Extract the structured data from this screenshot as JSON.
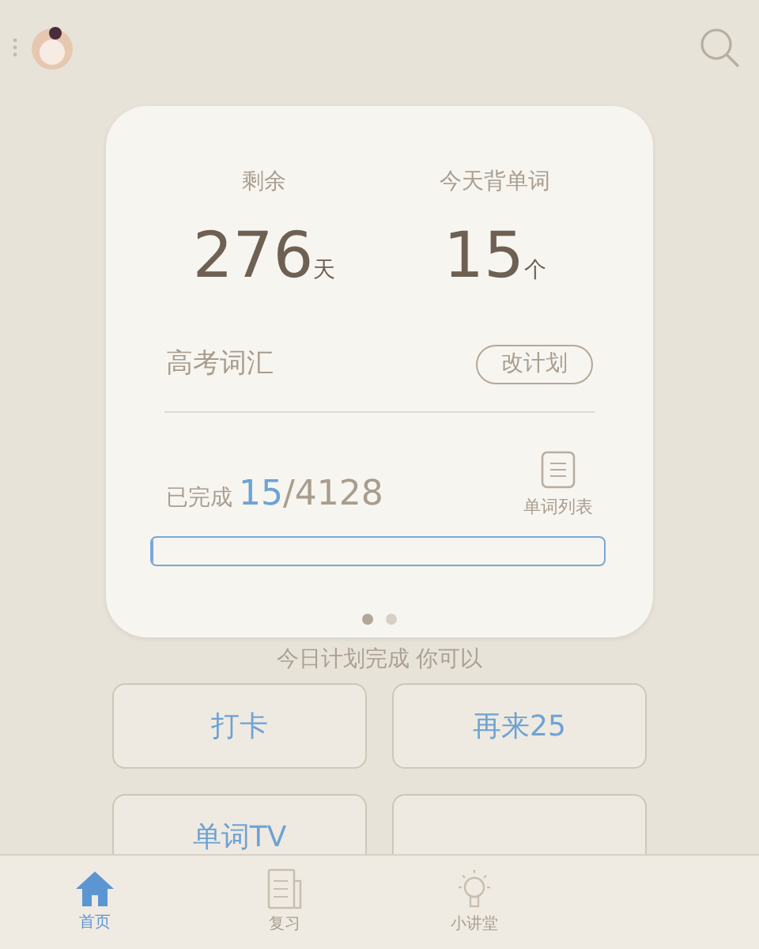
{
  "plan": {
    "stats": [
      {
        "label": "剩余",
        "value": "276",
        "unit": "天"
      },
      {
        "label": "今天背单词",
        "value": "15",
        "unit": "个"
      }
    ],
    "book": "高考词汇",
    "change_button": "改计划",
    "progress": {
      "label": "已完成",
      "done": "15",
      "total": "/4128",
      "level": 0.004
    },
    "word_list": "单词列表",
    "pages": [
      {
        "selected": true
      },
      {
        "selected": false
      }
    ]
  },
  "hint": "今日计划完成 你可以",
  "actions": [
    {
      "kind": "text",
      "label": "打卡"
    },
    {
      "kind": "text",
      "label": "再来25"
    },
    {
      "kind": "text",
      "label": "单词TV"
    },
    {
      "kind": "blank"
    }
  ],
  "tabs": [
    {
      "label": "首页",
      "selected": true,
      "kind": "home"
    },
    {
      "label": "复习",
      "selected": false,
      "kind": "review"
    },
    {
      "label": "小讲堂",
      "selected": false,
      "kind": "bulb"
    }
  ]
}
